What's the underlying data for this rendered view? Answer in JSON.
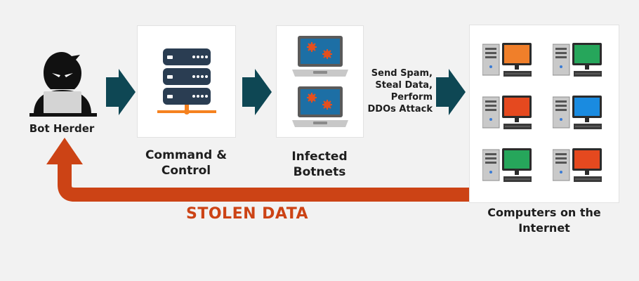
{
  "colors": {
    "arrow": "#0e4754",
    "return_arrow": "#cc4315",
    "server_body": "#2a3d52",
    "server_base": "#f58220",
    "malware": "#e3501e",
    "screen_blue": "#1d6fa5",
    "monitor_orange": "#f07f2a",
    "monitor_green": "#26a65b",
    "monitor_red": "#e5491f",
    "monitor_blue": "#1a8be0"
  },
  "nodes": {
    "bot_herder": {
      "label": "Bot Herder",
      "icon": "hacker-icon"
    },
    "command_control": {
      "label": "Command & Control",
      "icon": "server-icon"
    },
    "infected_botnets": {
      "lines": [
        "Infected",
        "Botnets"
      ],
      "icon": "laptop-icon"
    },
    "computers": {
      "lines": [
        "Computers on the",
        "Internet"
      ],
      "icon": "desktop-computer-icon",
      "monitors": [
        "orange",
        "green",
        "red",
        "blue",
        "green",
        "red"
      ]
    }
  },
  "actions": {
    "lines": [
      "Send Spam,",
      "Steal Data,",
      "Perform",
      "DDOs Attack"
    ]
  },
  "return_flow": {
    "label": "STOLEN DATA"
  }
}
